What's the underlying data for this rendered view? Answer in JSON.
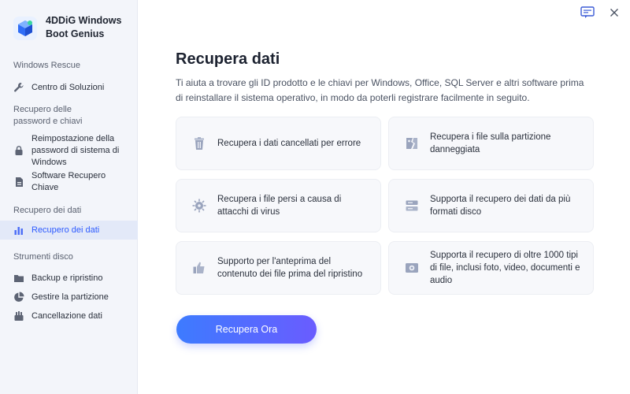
{
  "app": {
    "name": "4DDiG Windows Boot Genius"
  },
  "sidebar": {
    "sections": [
      {
        "title": "Windows Rescue",
        "items": [
          {
            "label": "Centro di Soluzioni",
            "icon": "wrench-icon"
          }
        ]
      },
      {
        "title": "Recupero delle password e chiavi",
        "items": [
          {
            "label": "Reimpostazione della password di sistema di Windows",
            "icon": "lock-icon"
          },
          {
            "label": "Software Recupero Chiave",
            "icon": "key-document-icon"
          }
        ]
      },
      {
        "title": "Recupero dei dati",
        "items": [
          {
            "label": "Recupero dei dati",
            "icon": "bar-chart-icon",
            "active": true
          }
        ]
      },
      {
        "title": "Strumenti disco",
        "items": [
          {
            "label": "Backup e ripristino",
            "icon": "folder-icon"
          },
          {
            "label": "Gestire la partizione",
            "icon": "pie-chart-icon"
          },
          {
            "label": "Cancellazione dati",
            "icon": "eraser-icon"
          }
        ]
      }
    ]
  },
  "header": {
    "feedback_icon": "feedback-icon",
    "close_icon": "close-icon"
  },
  "main": {
    "title": "Recupera dati",
    "description": "Ti aiuta a trovare gli ID prodotto e le chiavi per Windows, Office, SQL Server e altri software prima di reinstallare il sistema operativo, in modo da poterli registrare facilmente in seguito.",
    "features": [
      {
        "text": "Recupera i dati cancellati per errore",
        "icon": "trash-icon"
      },
      {
        "text": "Recupera i file sulla partizione danneggiata",
        "icon": "broken-file-icon"
      },
      {
        "text": "Recupera i file persi a causa di attacchi di virus",
        "icon": "virus-icon"
      },
      {
        "text": "Supporta il recupero dei dati da più formati disco",
        "icon": "disk-icon"
      },
      {
        "text": "Supporto per l'anteprima del contenuto dei file prima del ripristino",
        "icon": "thumbs-up-icon"
      },
      {
        "text": "Supporta il recupero di oltre 1000 tipi di file, inclusi foto, video, documenti e audio",
        "icon": "media-icon"
      }
    ],
    "cta_label": "Recupera Ora"
  },
  "colors": {
    "accent": "#4a6cf7",
    "cta_start": "#3d7bff",
    "cta_end": "#6a5cff",
    "sidebar_bg": "#f3f5fa",
    "icon_gray": "#8f97ab"
  }
}
